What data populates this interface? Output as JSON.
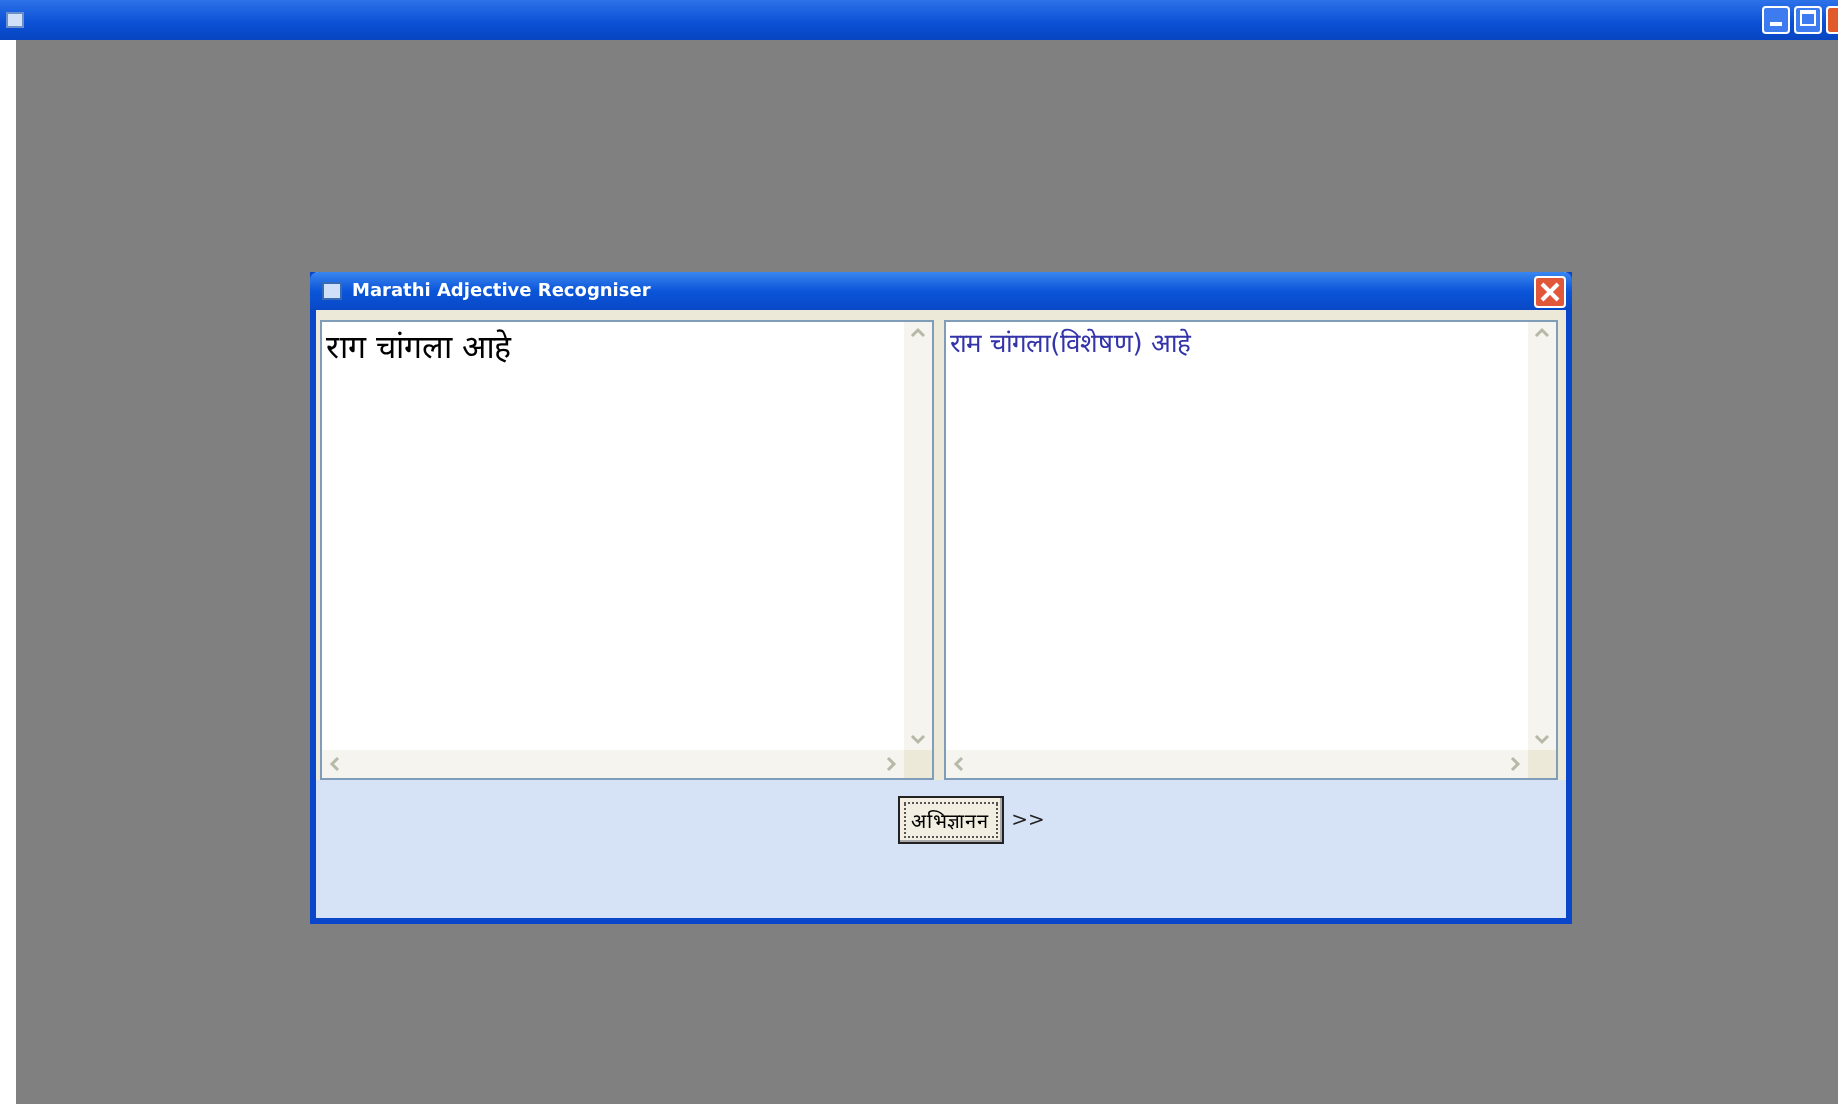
{
  "dialog": {
    "title": "Marathi Adjective Recogniser"
  },
  "input_box": {
    "value": "राग चांगला आहे"
  },
  "output_box": {
    "value": "राम चांगला(विशेषण) आहे"
  },
  "button": {
    "label": "अभिज्ञानन"
  },
  "arrow_label": ">>"
}
